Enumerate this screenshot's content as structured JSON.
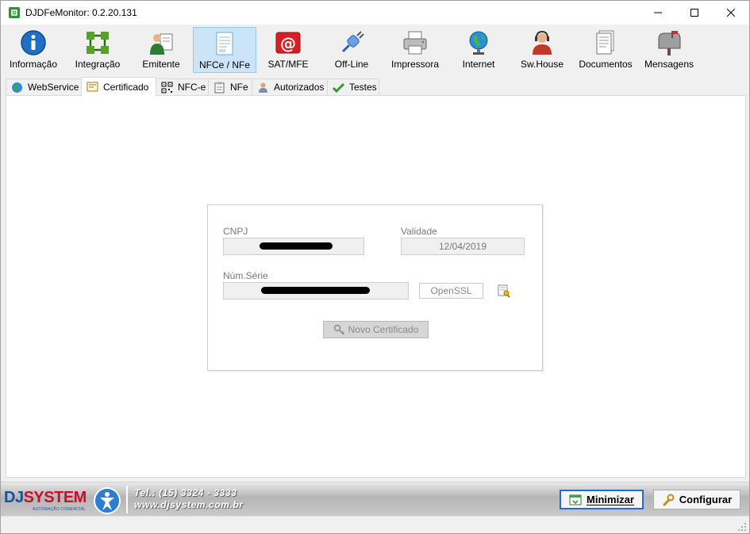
{
  "window": {
    "title": "DJDFeMonitor: 0.2.20.131"
  },
  "toolbar": {
    "items": [
      {
        "label": "Informação",
        "icon": "info-icon"
      },
      {
        "label": "Integração",
        "icon": "integration-icon"
      },
      {
        "label": "Emitente",
        "icon": "emitter-icon"
      },
      {
        "label": "NFCe / NFe",
        "icon": "document-icon",
        "active": true
      },
      {
        "label": "SAT/MFE",
        "icon": "at-sign-icon"
      },
      {
        "label": "Off-Line",
        "icon": "plug-icon"
      },
      {
        "label": "Impressora",
        "icon": "printer-icon"
      },
      {
        "label": "Internet",
        "icon": "globe-icon"
      },
      {
        "label": "Sw.House",
        "icon": "support-agent-icon"
      },
      {
        "label": "Documentos",
        "icon": "documents-icon"
      },
      {
        "label": "Mensagens",
        "icon": "mailbox-icon"
      }
    ]
  },
  "tabs": {
    "items": [
      {
        "label": "WebService"
      },
      {
        "label": "Certificado",
        "active": true
      },
      {
        "label": "NFC-e"
      },
      {
        "label": "NFe"
      },
      {
        "label": "Autorizados"
      },
      {
        "label": "Testes"
      }
    ]
  },
  "certificate": {
    "cnpj_label": "CNPJ",
    "validade_label": "Validade",
    "validade_value": "12/04/2019",
    "num_serie_label": "Núm.Série",
    "openssl_label": "OpenSSL",
    "new_cert_label": "Novo Certificado"
  },
  "footer": {
    "logo_dj": "DJ",
    "logo_system": "SYSTEM",
    "logo_sub": "AUTOMAÇÃO COMERCIAL",
    "phone": "Tel.: (15) 3324 - 3333",
    "website": "www.djsystem.com.br",
    "minimize_label": "Minimizar",
    "configure_label": "Configurar"
  }
}
